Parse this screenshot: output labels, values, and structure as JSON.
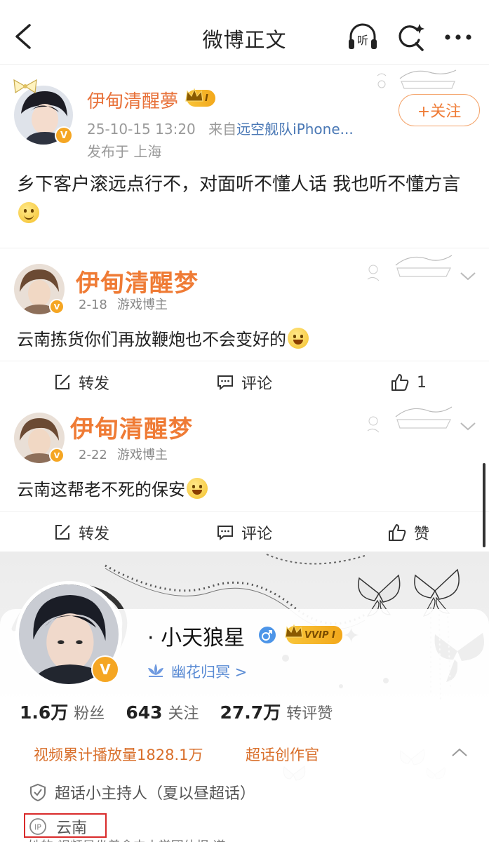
{
  "header": {
    "title": "微博正文",
    "listen_label": "听"
  },
  "post": {
    "author": "伊甸清醒夢",
    "vip_level": "I",
    "time": "25-10-15 13:20",
    "source_prefix": "来自",
    "source": "远空舰队iPhone...",
    "location": "发布于 上海",
    "follow_label": "+关注",
    "text": "乡下客户滚远点行不，对面听不懂人话 我也听不懂方言"
  },
  "comments": [
    {
      "author": "伊甸清醒梦",
      "date": "2-18",
      "tag": "游戏博主",
      "text": "云南拣货你们再放鞭炮也不会变好的",
      "repost_label": "转发",
      "comment_label": "评论",
      "like_label": "1"
    },
    {
      "author": "伊甸清醒梦",
      "date": "2-22",
      "tag": "游戏博主",
      "text": "云南这帮老不死的保安",
      "repost_label": "转发",
      "comment_label": "评论",
      "like_label": "赞"
    }
  ],
  "profile": {
    "name": "· 小天狼星",
    "vip": "VVIP I",
    "group": "幽花归冥 >",
    "stats": [
      {
        "num": "1.6万",
        "label": "粉丝"
      },
      {
        "num": "643",
        "label": "关注"
      },
      {
        "num": "27.7万",
        "label": "转评赞"
      }
    ],
    "tag_video": "视频累计播放量1828.1万",
    "tag_super": "超话创作官",
    "host": "超话小主持人（夏以昼超话）",
    "ip_label": "IP",
    "ip_location": "云南",
    "cut_text": "她的  视频是坐着盒中小学团体报 道"
  },
  "colors": {
    "accent": "#ef7b35",
    "link": "#4a78b5",
    "verified": "#f5a623",
    "highlight_box": "#d92a2a"
  },
  "icons": [
    "back-icon",
    "headphone-icon",
    "search-sparkle-icon",
    "more-icon",
    "repost-icon",
    "comment-icon",
    "like-icon",
    "chevron-down-icon",
    "ip-icon",
    "shield-icon",
    "lotus-icon",
    "male-icon"
  ]
}
